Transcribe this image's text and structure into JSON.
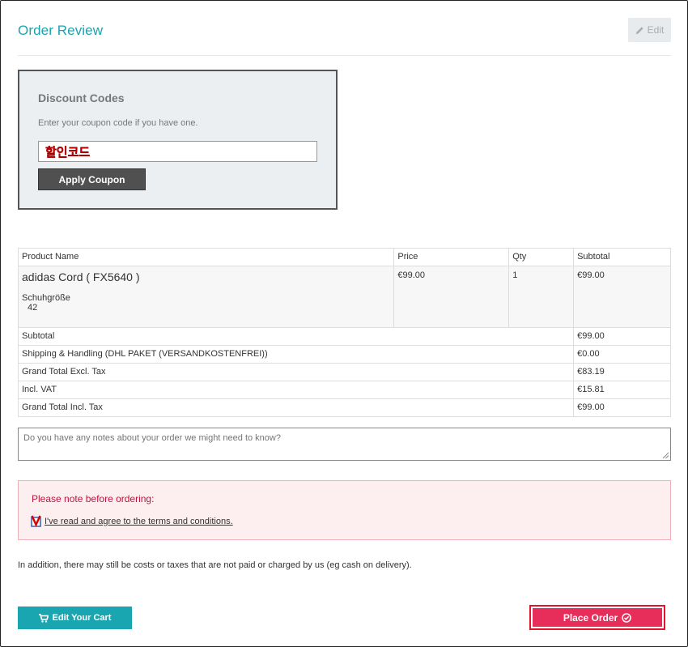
{
  "page": {
    "title": "Order Review",
    "edit_label": "Edit"
  },
  "discount": {
    "heading": "Discount Codes",
    "hint": "Enter your coupon code if you have one.",
    "input_value": "할인코드",
    "apply_label": "Apply Coupon"
  },
  "table": {
    "headers": [
      "Product Name",
      "Price",
      "Qty",
      "Subtotal"
    ],
    "product": {
      "name": "adidas Cord ( FX5640 )",
      "option_label": "Schuhgröße",
      "option_value": "42",
      "price": "€99.00",
      "qty": "1",
      "subtotal": "€99.00"
    },
    "totals": [
      {
        "label": "Subtotal",
        "value": "€99.00"
      },
      {
        "label": "Shipping & Handling (DHL PAKET (VERSANDKOSTENFREI))",
        "value": "€0.00"
      },
      {
        "label": "Grand Total Excl. Tax",
        "value": "€83.19"
      },
      {
        "label": "Incl. VAT",
        "value": "€15.81"
      },
      {
        "label": "Grand Total Incl. Tax",
        "value": "€99.00"
      }
    ]
  },
  "notes": {
    "placeholder": "Do you have any notes about your order we might need to know?"
  },
  "notice": {
    "heading": "Please note before ordering:",
    "checkbox_mark": "V",
    "terms_label": "I've read and agree to the terms and conditions."
  },
  "info": "In addition, there may still be costs or taxes that are not paid or charged by us (eg cash on delivery).",
  "buttons": {
    "edit_cart": "Edit Your Cart",
    "place_order": "Place Order"
  },
  "colors": {
    "accent": "#1ba3ad",
    "place_order": "#e72e5a",
    "notice_text": "#c0143c"
  },
  "icons": {
    "edit": "pencil-icon",
    "cart": "cart-icon",
    "order": "check-circle-icon"
  }
}
